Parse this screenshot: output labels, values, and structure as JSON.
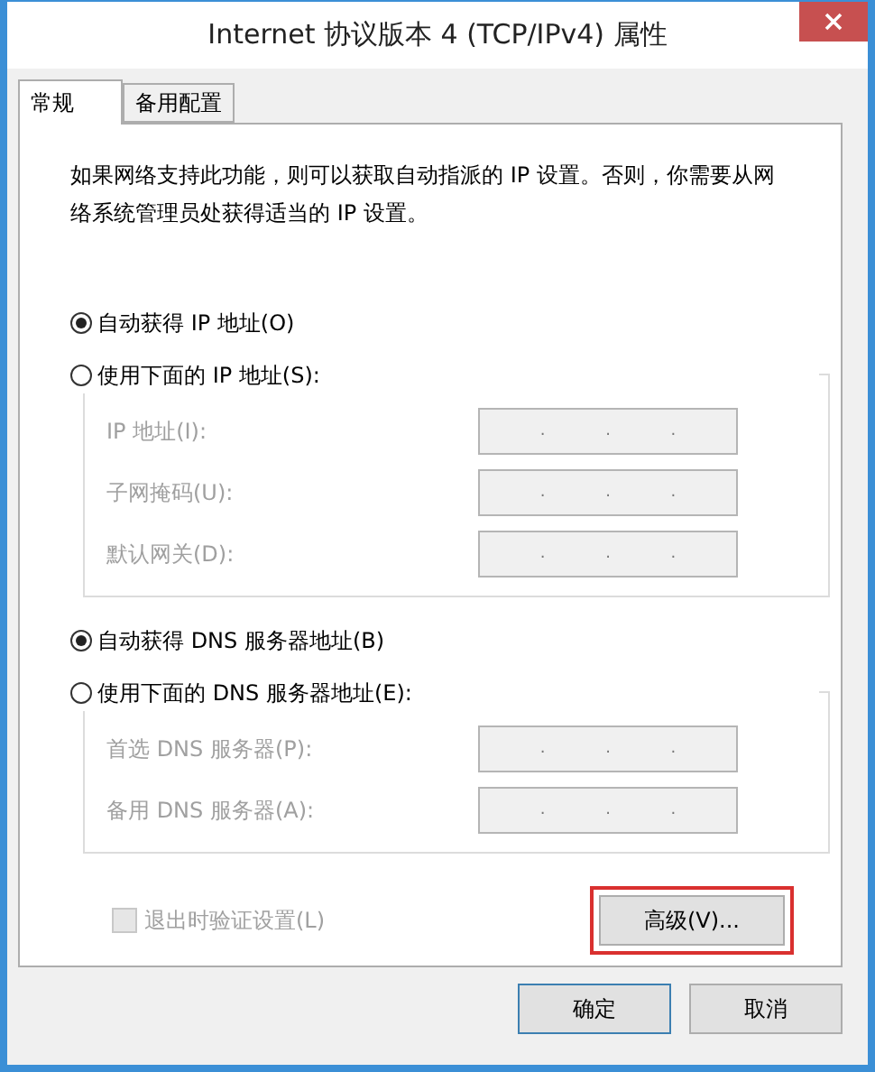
{
  "window": {
    "title": "Internet 协议版本 4 (TCP/IPv4) 属性"
  },
  "tabs": [
    {
      "label": "常规",
      "selected": true
    },
    {
      "label": "备用配置",
      "selected": false
    }
  ],
  "description": "如果网络支持此功能，则可以获取自动指派的 IP 设置。否则，你需要从网络系统管理员处获得适当的 IP 设置。",
  "groups": [
    {
      "auto_option": {
        "label": "自动获得 IP 地址(O)",
        "selected": true
      },
      "manual_option": {
        "label": "使用下面的 IP 地址(S):",
        "selected": false
      },
      "fields": [
        {
          "label": "IP 地址(I):",
          "disabled": true,
          "separator": "."
        },
        {
          "label": "子网掩码(U):",
          "disabled": true,
          "separator": "."
        },
        {
          "label": "默认网关(D):",
          "disabled": true,
          "separator": "."
        }
      ]
    },
    {
      "auto_option": {
        "label": "自动获得 DNS 服务器地址(B)",
        "selected": true
      },
      "manual_option": {
        "label": "使用下面的 DNS 服务器地址(E):",
        "selected": false
      },
      "fields": [
        {
          "label": "首选 DNS 服务器(P):",
          "disabled": true,
          "separator": "."
        },
        {
          "label": "备用 DNS 服务器(A):",
          "disabled": true,
          "separator": "."
        }
      ]
    }
  ],
  "validate_checkbox": {
    "label": "退出时验证设置(L)",
    "checked": false,
    "disabled": true
  },
  "advanced_button": {
    "label": "高级(V)...",
    "highlighted": true
  },
  "buttons": [
    {
      "label": "确定",
      "default": true
    },
    {
      "label": "取消",
      "default": false
    }
  ]
}
